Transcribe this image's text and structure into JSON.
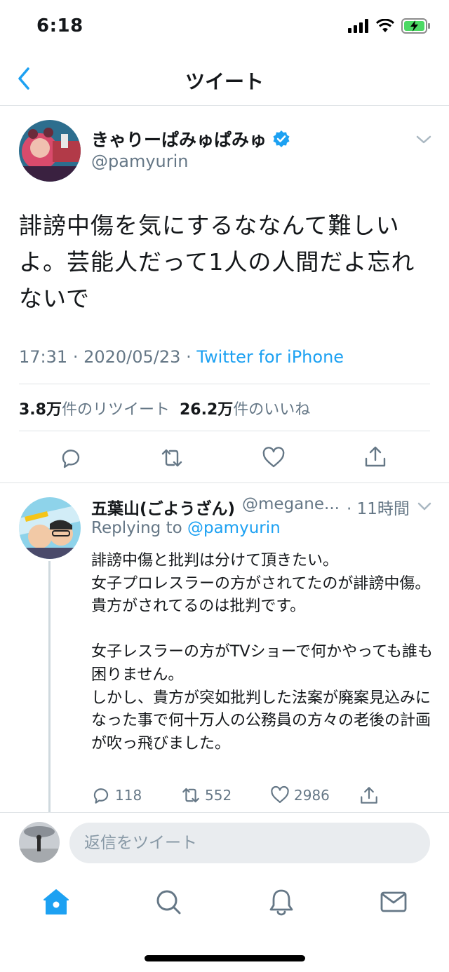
{
  "status_bar": {
    "time": "6:18"
  },
  "nav": {
    "title": "ツイート"
  },
  "tweet": {
    "author_name": "きゃりーぱみゅぱみゅ",
    "author_handle": "@pamyurin",
    "text": "誹謗中傷を気にするななんて難しいよ。芸能人だって1人の人間だよ忘れないで",
    "time": "17:31",
    "date": "2020/05/23",
    "source": "Twitter for iPhone",
    "separator": "·",
    "retweet_count": "3.8万",
    "retweet_label": "件のリツイート",
    "like_count": "26.2万",
    "like_label": "件のいいね"
  },
  "reply": {
    "author_name": "五葉山(ごようざん)",
    "author_handle": "@megane...",
    "time": "· 11時間",
    "replying_prefix": "Replying to ",
    "replying_to": "@pamyurin",
    "text": "誹謗中傷と批判は分けて頂きたい。\n女子プロレスラーの方がされてたのが誹謗中傷。\n貴方がされてるのは批判です。\n\n女子レスラーの方がTVショーで何かやっても誰も困りません。\nしかし、貴方が突如批判した法案が廃案見込みになった事で何十万人の公務員の方々の老後の計画が吹っ飛びました。",
    "reply_count": "118",
    "retweet_count": "552",
    "like_count": "2986"
  },
  "compose": {
    "placeholder": "返信をツイート"
  },
  "colors": {
    "accent": "#1da1f2",
    "secondary_text": "#657786",
    "verified": "#1da1f2"
  },
  "icons": [
    "back-chevron-icon",
    "verified-badge-icon",
    "chevron-down-icon",
    "reply-icon",
    "retweet-icon",
    "like-icon",
    "share-icon",
    "home-icon",
    "search-icon",
    "notifications-icon",
    "messages-icon"
  ]
}
